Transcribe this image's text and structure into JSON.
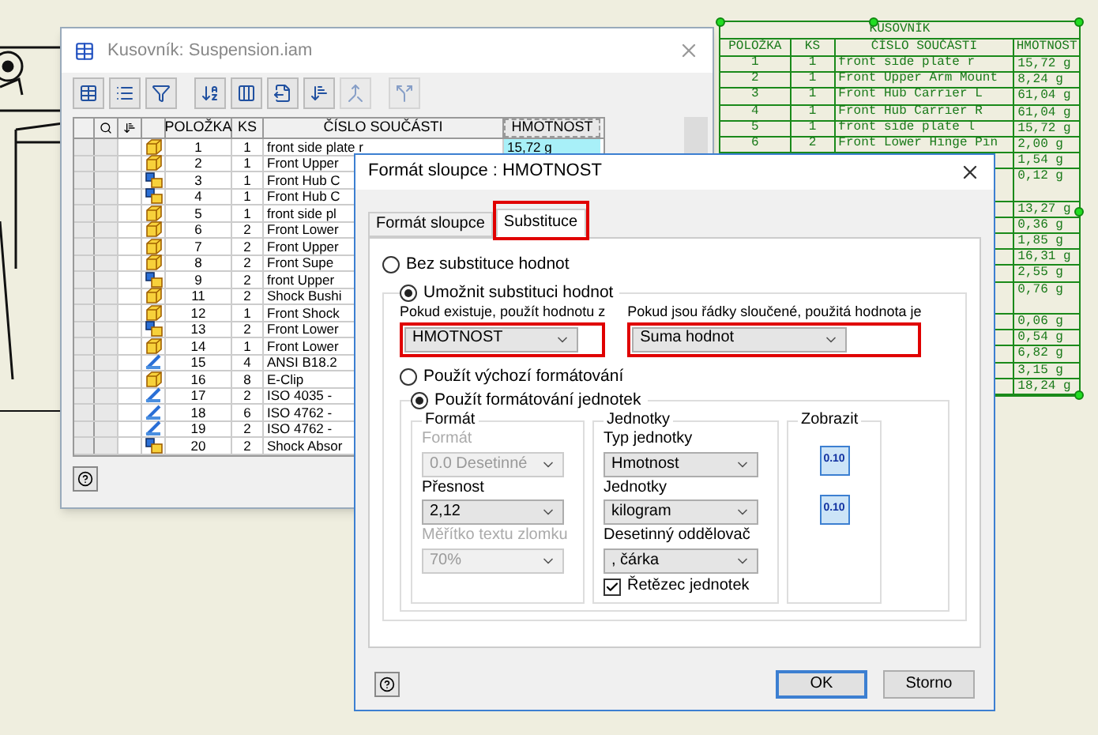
{
  "drawing_bom": {
    "title": "KUSOVNÍK",
    "columns": [
      "POLOŽKA",
      "KS",
      "ČÍSLO SOUČÁSTI",
      "HMOTNOST"
    ],
    "rows": [
      {
        "polozka": "1",
        "ks": "1",
        "cislo": "front side plate r",
        "hmotnost": "15,72 g",
        "wrapped": false
      },
      {
        "polozka": "2",
        "ks": "1",
        "cislo": "Front Upper Arm Mount",
        "hmotnost": "8,24 g",
        "wrapped": false
      },
      {
        "polozka": "3",
        "ks": "1",
        "cislo": "Front Hub Carrier L",
        "hmotnost": "61,04 g",
        "wrapped": false
      },
      {
        "polozka": "4",
        "ks": "1",
        "cislo": "Front Hub Carrier R",
        "hmotnost": "61,04 g",
        "wrapped": false
      },
      {
        "polozka": "5",
        "ks": "1",
        "cislo": "front side plate l",
        "hmotnost": "15,72 g",
        "wrapped": false
      },
      {
        "polozka": "6",
        "ks": "2",
        "cislo": "Front Lower Hinge Pin",
        "hmotnost": "2,00 g",
        "wrapped": false
      },
      {
        "hmotnost": "1,54 g",
        "wrapped": false
      },
      {
        "hmotnost": "0,12 g",
        "wrapped": true
      },
      {
        "hmotnost": "13,27 g",
        "wrapped": false
      },
      {
        "hmotnost": "0,36 g",
        "wrapped": false
      },
      {
        "hmotnost": "1,85 g",
        "wrapped": false
      },
      {
        "hmotnost": "16,31 g",
        "wrapped": false
      },
      {
        "hmotnost": "2,55 g",
        "wrapped": false
      },
      {
        "hmotnost": "0,76 g",
        "wrapped": true
      },
      {
        "hmotnost": "0,06 g",
        "wrapped": false
      },
      {
        "hmotnost": "0,54 g",
        "wrapped": false
      },
      {
        "hmotnost": "6,82 g",
        "wrapped": false
      },
      {
        "hmotnost": "3,15 g",
        "wrapped": false
      },
      {
        "hmotnost": "18,24 g",
        "wrapped": false
      }
    ]
  },
  "bom_window": {
    "title": "Kusovník: Suspension.iam",
    "toolbar": [
      {
        "kind": "grid"
      },
      {
        "kind": "list"
      },
      {
        "kind": "filter"
      },
      {
        "kind": "sort"
      },
      {
        "kind": "columns"
      },
      {
        "kind": "export"
      },
      {
        "kind": "split"
      },
      {
        "kind": "merge"
      },
      {
        "kind": "separate"
      }
    ],
    "columns": [
      {
        "label": "POLOŽKA",
        "selected": false
      },
      {
        "label": "KS",
        "selected": false
      },
      {
        "label": "ČÍSLO SOUČÁSTI",
        "selected": false
      },
      {
        "label": "HMOTNOST",
        "selected": true
      }
    ],
    "rows": [
      {
        "kind": "part",
        "polozka": "1",
        "ks": "1",
        "cislo": "front side plate r",
        "hmotnost": "15,72 g"
      },
      {
        "kind": "part",
        "polozka": "2",
        "ks": "1",
        "cislo": "Front Upper"
      },
      {
        "kind": "assembly",
        "polozka": "3",
        "ks": "1",
        "cislo": "Front Hub C"
      },
      {
        "kind": "assembly",
        "polozka": "4",
        "ks": "1",
        "cislo": "Front Hub C"
      },
      {
        "kind": "part",
        "polozka": "5",
        "ks": "1",
        "cislo": "front side pl"
      },
      {
        "kind": "part",
        "polozka": "6",
        "ks": "2",
        "cislo": "Front Lower"
      },
      {
        "kind": "part",
        "polozka": "7",
        "ks": "2",
        "cislo": "Front Upper"
      },
      {
        "kind": "part",
        "polozka": "8",
        "ks": "2",
        "cislo": "Front Supe"
      },
      {
        "kind": "assembly",
        "polozka": "9",
        "ks": "2",
        "cislo": "front Upper"
      },
      {
        "kind": "part",
        "polozka": "11",
        "ks": "2",
        "cislo": "Shock Bushi"
      },
      {
        "kind": "part",
        "polozka": "12",
        "ks": "1",
        "cislo": "Front Shock"
      },
      {
        "kind": "assembly",
        "polozka": "13",
        "ks": "2",
        "cislo": "Front Lower"
      },
      {
        "kind": "part",
        "polozka": "14",
        "ks": "1",
        "cislo": "Front Lower"
      },
      {
        "kind": "fastener",
        "polozka": "15",
        "ks": "4",
        "cislo": "ANSI B18.2"
      },
      {
        "kind": "part",
        "polozka": "16",
        "ks": "8",
        "cislo": "E-Clip"
      },
      {
        "kind": "fastener",
        "polozka": "17",
        "ks": "2",
        "cislo": "ISO 4035 -"
      },
      {
        "kind": "fastener",
        "polozka": "18",
        "ks": "6",
        "cislo": "ISO 4762 -"
      },
      {
        "kind": "fastener",
        "polozka": "19",
        "ks": "2",
        "cislo": "ISO 4762 -"
      },
      {
        "kind": "assembly",
        "polozka": "20",
        "ks": "2",
        "cislo": "Shock Absor"
      }
    ]
  },
  "dialog": {
    "title": "Formát sloupce : HMOTNOST",
    "tabs": [
      {
        "label": "Formát sloupce",
        "selected": false,
        "highlighted": false
      },
      {
        "label": "Substituce",
        "selected": true,
        "highlighted": true
      }
    ],
    "no_substitution": {
      "label": "Bez substituce hodnot",
      "selected": false
    },
    "allow_substitution": {
      "label": "Umožnit substituci hodnot",
      "selected": true
    },
    "source": {
      "label": "Pokud existuje, použít hodnotu z",
      "value": "HMOTNOST",
      "highlighted": true
    },
    "merged": {
      "label": "Pokud jsou řádky sloučené, použitá hodnota je",
      "value": "Suma hodnot",
      "highlighted": true
    },
    "default_format": {
      "label": "Použít výchozí formátování",
      "selected": false
    },
    "unit_format": {
      "label": "Použít formátování jednotek",
      "selected": true
    },
    "format_group": {
      "title": "Formát",
      "fields": [
        {
          "label": "Formát",
          "value": "0.0 Desetinné",
          "disabled": true
        },
        {
          "label": "Přesnost",
          "value": "2,12",
          "disabled": false
        },
        {
          "label": "Měřítko textu zlomku",
          "value": "70%",
          "disabled": true
        }
      ]
    },
    "units_group": {
      "title": "Jednotky",
      "fields": [
        {
          "label": "Typ jednotky",
          "value": "Hmotnost"
        },
        {
          "label": "Jednotky",
          "value": "kilogram"
        },
        {
          "label": "Desetinný oddělovač",
          "value": ", čárka"
        }
      ],
      "unit_string": {
        "label": "Řetězec jednotek",
        "checked": true
      }
    },
    "display_group": {
      "title": "Zobrazit",
      "buttons": [
        "0.10",
        "0.10"
      ]
    },
    "buttons": [
      "OK",
      "Storno"
    ]
  }
}
